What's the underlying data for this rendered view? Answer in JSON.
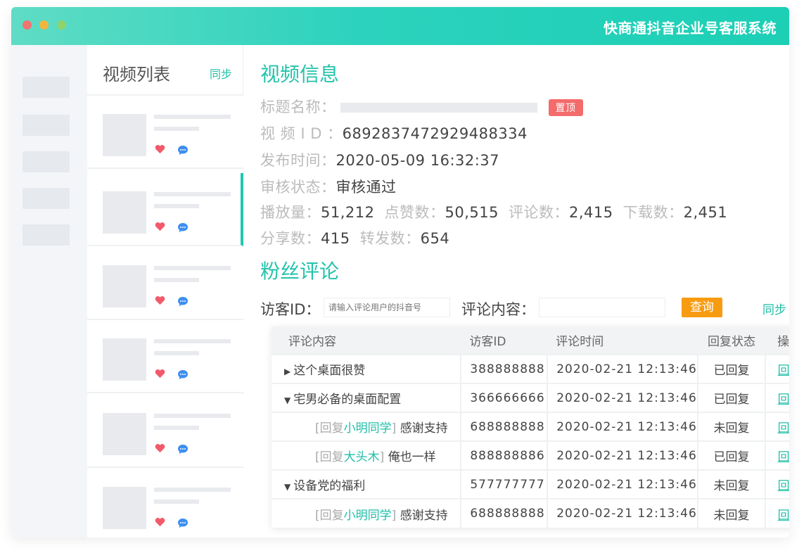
{
  "app": {
    "title": "快商通抖音企业号客服系统"
  },
  "video_list": {
    "title": "视频列表",
    "sync_label": "同步",
    "card_count": 6
  },
  "video_info": {
    "section_title": "视频信息",
    "title_label": "标题名称：",
    "pin_badge": "置顶",
    "id_label": "视 频 I D ：",
    "id_value": "6892837472929488334",
    "publish_label": "发布时间：",
    "publish_value": "2020-05-09 16:32:37",
    "review_label": "审核状态：",
    "review_value": "审核通过",
    "stats": {
      "play_label": "播放量：",
      "play_value": "51,212",
      "like_label": "点赞数：",
      "like_value": "50,515",
      "comment_label": "评论数：",
      "comment_value": "2,415",
      "download_label": "下载数：",
      "download_value": "2,451",
      "share_label": "分享数：",
      "share_value": "415",
      "forward_label": "转发数：",
      "forward_value": "654"
    }
  },
  "comments": {
    "section_title": "粉丝评论",
    "visitor_label": "访客ID：",
    "visitor_placeholder": "请输入评论用户的抖音号",
    "content_label": "评论内容：",
    "content_placeholder": "",
    "query_label": "查询",
    "sync_label": "同步",
    "headers": [
      "评论内容",
      "访客ID",
      "评论时间",
      "回复状态",
      "操作"
    ],
    "rows": [
      {
        "type": "top",
        "toggle": "▶",
        "content": "这个桌面很赞",
        "visitor": "388888888",
        "time": "2020-02-21 12:13:46",
        "status": "已回复",
        "action": "回复"
      },
      {
        "type": "top",
        "toggle": "▼",
        "content": "宅男必备的桌面配置",
        "visitor": "366666666",
        "time": "2020-02-21 12:13:46",
        "status": "已回复",
        "action": "回复"
      },
      {
        "type": "reply",
        "prefix": "[回复",
        "name": "小明同学",
        "suffix": "]",
        "content": "感谢支持",
        "visitor": "688888888",
        "time": "2020-02-21 12:13:46",
        "status": "未回复",
        "action": "回复"
      },
      {
        "type": "reply",
        "prefix": "[回复",
        "name": "大头木",
        "suffix": "]",
        "content": "俺也一样",
        "visitor": "888888886",
        "time": "2020-02-21 12:13:46",
        "status": "已回复",
        "action": "回复"
      },
      {
        "type": "top",
        "toggle": "▼",
        "content": "设备党的福利",
        "visitor": "577777777",
        "time": "2020-02-21 12:13:46",
        "status": "未回复",
        "action": "回复"
      },
      {
        "type": "reply",
        "prefix": "[回复",
        "name": "小明同学",
        "suffix": "]",
        "content": "感谢支持",
        "visitor": "688888888",
        "time": "2020-02-21 12:13:46",
        "status": "未回复",
        "action": "回复"
      }
    ]
  },
  "colors": {
    "accent": "#1fbfa7",
    "header_gradient_start": "#5fdcc5",
    "header_gradient_end": "#1ccfb5",
    "query_button": "#f79c11",
    "pin_badge": "#f36b6b",
    "heart": "#f25a6a",
    "comment_icon": "#3d8ef0"
  },
  "icons": {
    "window_controls": [
      "close-dot",
      "minimize-dot",
      "maximize-dot"
    ],
    "card_icons": [
      "heart-icon",
      "comment-bubble-icon"
    ]
  }
}
